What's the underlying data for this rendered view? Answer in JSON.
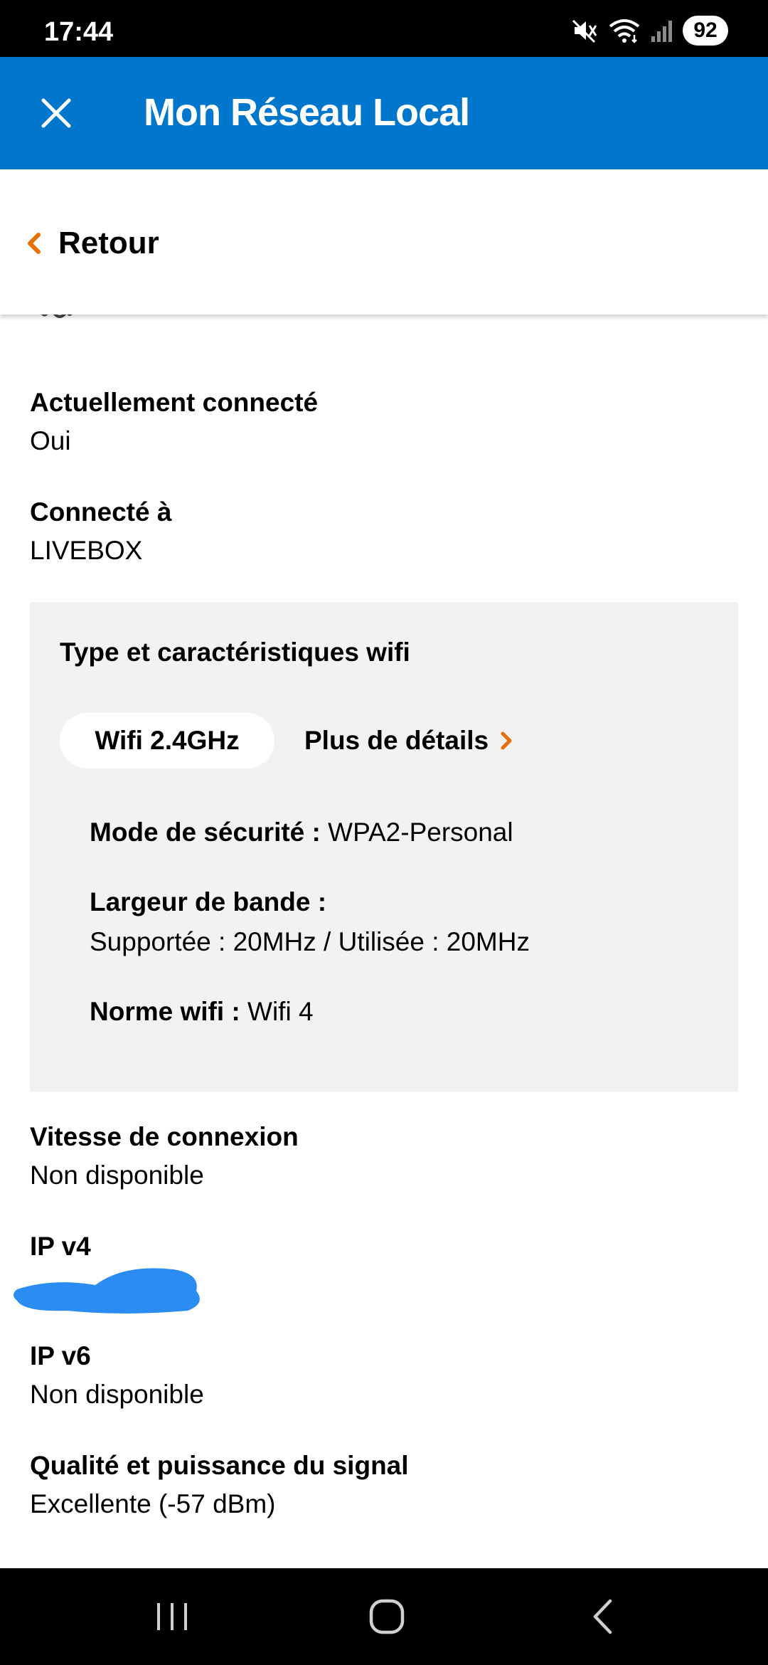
{
  "status_bar": {
    "time": "17:44",
    "battery": "92",
    "icons": [
      "mute-icon",
      "wifi-icon",
      "signal-icon"
    ]
  },
  "header": {
    "title": "Mon Réseau Local",
    "close_icon": "close-icon",
    "background_color": "#0077cc"
  },
  "back": {
    "label": "Retour",
    "accent_color": "#e8700a"
  },
  "fields": {
    "connected": {
      "label": "Actuellement connecté",
      "value": "Oui"
    },
    "connected_to": {
      "label": "Connecté à",
      "value": "LIVEBOX"
    },
    "speed": {
      "label": "Vitesse de connexion",
      "value": "Non disponible"
    },
    "ipv4": {
      "label": "IP v4",
      "value": ""
    },
    "ipv6": {
      "label": "IP v6",
      "value": "Non disponible"
    },
    "signal": {
      "label": "Qualité et puissance du signal",
      "value": "Excellente (-57 dBm)"
    }
  },
  "wifi_panel": {
    "title": "Type et caractéristiques wifi",
    "band": "Wifi 2.4GHz",
    "details_link": "Plus de détails",
    "security_label": "Mode de sécurité :",
    "security_value": "WPA2-Personal",
    "bandwidth_label": "Largeur de bande :",
    "bandwidth_value": "Supportée : 20MHz / Utilisée : 20MHz",
    "norm_label": "Norme wifi :",
    "norm_value": "Wifi 4"
  },
  "redaction_color": "#2b8cf2",
  "nav": {
    "icons": [
      "recent-apps-icon",
      "home-icon",
      "back-nav-icon"
    ]
  }
}
